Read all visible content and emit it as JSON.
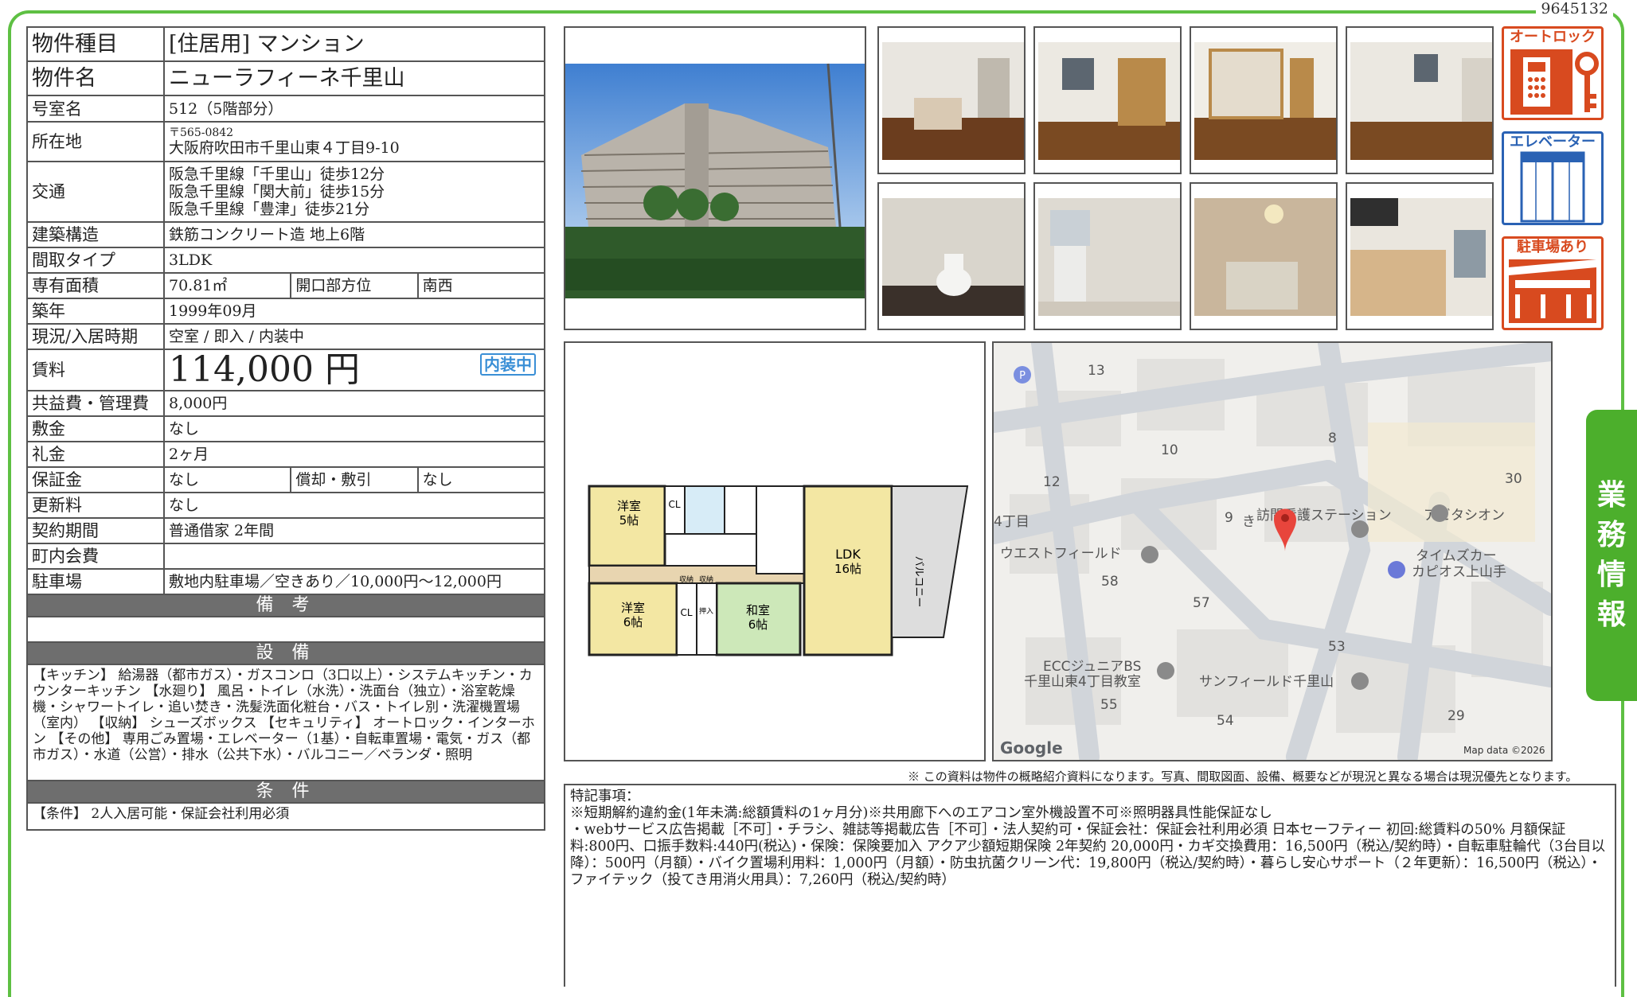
{
  "doc_id": "9645132",
  "side_tab": [
    "業",
    "務",
    "情",
    "報"
  ],
  "table": {
    "type_label": "物件種目",
    "type_value": "[住居用]  マンション",
    "name_label": "物件名",
    "name_value": "ニューラフィーネ千里山",
    "room_label": "号室名",
    "room_value": "512（5階部分）",
    "addr_label": "所在地",
    "addr_zip": "〒565-0842",
    "addr_value": "大阪府吹田市千里山東４丁目9-10",
    "access_label": "交通",
    "access": [
      "阪急千里線「千里山」徒歩12分",
      "阪急千里線「関大前」徒歩15分",
      "阪急千里線「豊津」徒歩21分"
    ],
    "struct_label": "建築構造",
    "struct_value": "鉄筋コンクリート造  地上6階",
    "layout_label": "間取タイプ",
    "layout_value": "3LDK",
    "area_label": "専有面積",
    "area_value": "70.81㎡",
    "dir_label": "開口部方位",
    "dir_value": "南西",
    "built_label": "築年",
    "built_value": "1999年09月",
    "status_label": "現況/入居時期",
    "status_value": "空室  /  即入  /  内装中",
    "rent_label": "賃料",
    "rent_value": "114,000 円",
    "rent_badge": "内装中",
    "fee_label": "共益費・管理費",
    "fee_value": "8,000円",
    "deposit_label": "敷金",
    "deposit_value": "なし",
    "key_label": "礼金",
    "key_value": "2ヶ月",
    "guar_label": "保証金",
    "guar_value": "なし",
    "amort_label": "償却・敷引",
    "amort_value": "なし",
    "renew_label": "更新料",
    "renew_value": "なし",
    "contract_label": "契約期間",
    "contract_value": "普通借家 2年間",
    "town_label": "町内会費",
    "town_value": "",
    "parking_label": "駐車場",
    "parking_value": "敷地内駐車場／空きあり／10,000円～12,000円",
    "remarks_header": "備 考",
    "remarks_value": "",
    "equip_header": "設 備",
    "equip_value": "【キッチン】 給湯器（都市ガス）・ガスコンロ（3口以上）・システムキッチン・カウンターキッチン 【水廻り】 風呂・トイレ（水洗）・洗面台（独立）・浴室乾燥機・シャワートイレ・追い焚き・洗髪洗面化粧台・バス・トイレ別・洗濯機置場（室内） 【収納】 シューズボックス 【セキュリティ】 オートロック・インターホン 【その他】 専用ごみ置場・エレベーター（1基）・自転車置場・電気・ガス（都市ガス）・水道（公営）・排水（公共下水）・バルコニー／ベランダ・照明",
    "cond_header": "条 件",
    "cond_value": "【条件】 2人入居可能・保証会社利用必須"
  },
  "features": {
    "autolock": "オートロック",
    "elevator": "エレベーター",
    "parking": "駐車場あり"
  },
  "floorplan": {
    "rooms": [
      "洋室",
      "5帖",
      "洋室",
      "6帖",
      "和室",
      "6帖",
      "LDK",
      "16帖",
      "バルコニー",
      "CL",
      "CL",
      "収納",
      "収納",
      "押入"
    ]
  },
  "map": {
    "labels": [
      "13",
      "10",
      "8",
      "12",
      "30",
      "9",
      "4丁目",
      "ウエストフィールド",
      "58",
      "57",
      "53",
      "ECCジュニアBS",
      "千里山東4丁目教室",
      "サンフィールド千里山",
      "55",
      "54",
      "29",
      "訪問看護ステーション",
      "アビタシオン",
      "タイムズカー",
      "カピオス上山手",
      "き"
    ],
    "google": "Google",
    "mapdata": "Map data ©2026"
  },
  "note": "※ この資料は物件の概略紹介資料になります。写真、間取図面、設備、概要などが現況と異なる場合は現況優先となります。",
  "special": {
    "title": "特記事項：",
    "line1": "※短期解約違約金(1年未満:総額賃料の1ヶ月分)※共用廊下へのエアコン室外機設置不可※照明器具性能保証なし",
    "line2": "・webサービス広告掲載［不可］・チラシ、雑誌等掲載広告［不可］・法人契約可・保証会社：保証会社利用必須 日本セーフティー 初回:総賃料の50% 月額保証料:800円、口振手数料:440円(税込)・保険：保険要加入 アクア少額短期保険 2年契約 20,000円・カギ交換費用：16,500円（税込/契約時）・自転車駐輪代（3台目以降）：500円（月額）・バイク置場利用料：1,000円（月額）・防虫抗菌クリーン代：19,800円（税込/契約時）・暮らし安心サポート（２年更新）：16,500円（税込）・ファイテック（投てき用消火用具）：7,260円（税込/契約時）"
  }
}
